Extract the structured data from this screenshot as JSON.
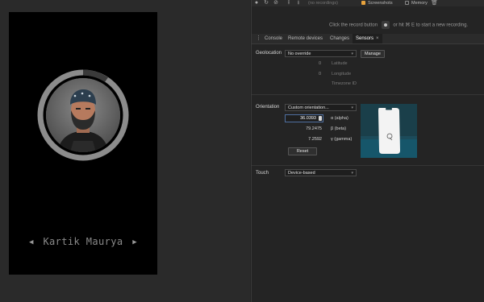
{
  "device": {
    "profile_name": "Kartik Maurya",
    "prev_icon": "triangle-left-icon",
    "next_icon": "triangle-right-icon"
  },
  "toolbar": {
    "recording_select": "(no recordings)",
    "screenshots_label": "Screenshots",
    "memory_label": "Memory",
    "checkbox_color": "#e8a33d"
  },
  "recording_hint": {
    "before": "Click the record button",
    "after": "or hit ⌘ E to start a new recording."
  },
  "tabs": [
    {
      "label": "Console"
    },
    {
      "label": "Remote devices"
    },
    {
      "label": "Changes"
    },
    {
      "label": "Sensors",
      "active": true,
      "close": "×"
    }
  ],
  "sensors": {
    "geolocation": {
      "label": "Geolocation",
      "selected": "No override",
      "manage_label": "Manage",
      "latitude_value": "0",
      "latitude_label": "Latitude",
      "longitude_value": "0",
      "longitude_label": "Longitude",
      "timezone_label": "Timezone ID"
    },
    "orientation": {
      "label": "Orientation",
      "selected": "Custom orientation...",
      "alpha_value": "36.0393",
      "alpha_label": "α (alpha)",
      "beta_value": "79.2475",
      "beta_label": "β (beta)",
      "gamma_value": "7.2592",
      "gamma_label": "γ (gamma)",
      "reset_label": "Reset"
    },
    "touch": {
      "label": "Touch",
      "selected": "Device-based"
    }
  },
  "colors": {
    "accent_blue": "#4f6fa0",
    "orientation_bg": "#1a3f4a"
  }
}
